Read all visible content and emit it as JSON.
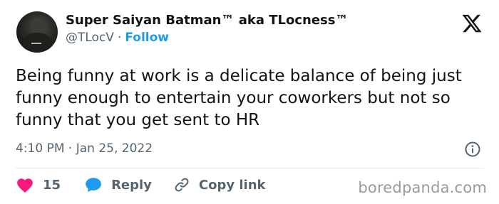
{
  "author": {
    "display_name": "Super Saiyan Batman™ aka TLocness™",
    "handle": "@TLocV",
    "separator": "·",
    "follow_label": "Follow"
  },
  "tweet": {
    "text": "Being funny at work is a delicate balance of being just funny enough to entertain your coworkers but not so funny that you get sent to HR",
    "timestamp": "4:10 PM · Jan 25, 2022"
  },
  "actions": {
    "like_count": "15",
    "reply_label": "Reply",
    "copy_link_label": "Copy link"
  },
  "watermark": "boredpanda.com",
  "icons": {
    "like": "heart-icon",
    "reply": "speech-bubble-icon",
    "copy_link": "link-icon",
    "brand": "x-logo-icon",
    "info": "info-icon"
  },
  "colors": {
    "like": "#f91880",
    "reply": "#1d9bf0",
    "follow": "#1d9bf0",
    "secondary_text": "#536471"
  }
}
